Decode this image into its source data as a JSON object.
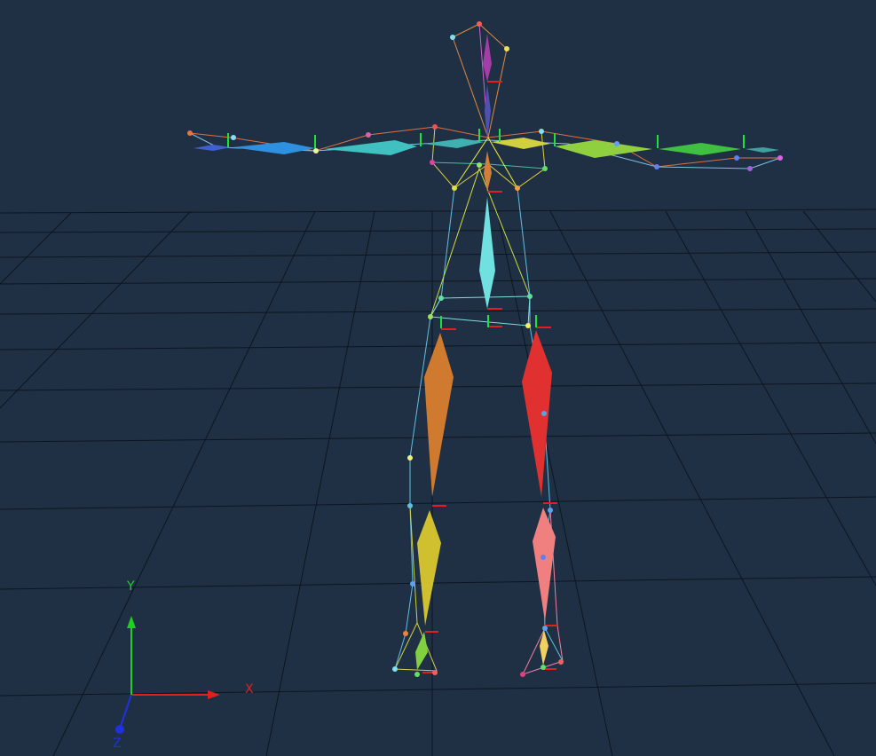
{
  "viewport": {
    "background": "#1f3044",
    "grid_color": "#0d1520"
  },
  "axes_gizmo": {
    "x_label": "X",
    "y_label": "Y",
    "z_label": "Z",
    "x_color": "#e02020",
    "y_color": "#20d020",
    "z_color": "#2030e0"
  },
  "skeleton": {
    "bones": [
      {
        "name": "head",
        "color": "#b040b0"
      },
      {
        "name": "neck",
        "color": "#5050b0"
      },
      {
        "name": "spine-upper",
        "color": "#d0803a"
      },
      {
        "name": "spine",
        "color": "#70e0e0"
      },
      {
        "name": "left-upper-arm",
        "color": "#40c0c0"
      },
      {
        "name": "left-forearm",
        "color": "#3090e0"
      },
      {
        "name": "left-hand",
        "color": "#4060d0"
      },
      {
        "name": "right-upper-arm",
        "color": "#d0d040"
      },
      {
        "name": "right-forearm",
        "color": "#90d040"
      },
      {
        "name": "right-hand",
        "color": "#40c040"
      },
      {
        "name": "left-thigh",
        "color": "#d07a30"
      },
      {
        "name": "left-shin",
        "color": "#d0c030"
      },
      {
        "name": "left-foot",
        "color": "#80d040"
      },
      {
        "name": "right-thigh",
        "color": "#e03030"
      },
      {
        "name": "right-shin",
        "color": "#f08080"
      },
      {
        "name": "right-foot",
        "color": "#f0d060"
      }
    ]
  }
}
